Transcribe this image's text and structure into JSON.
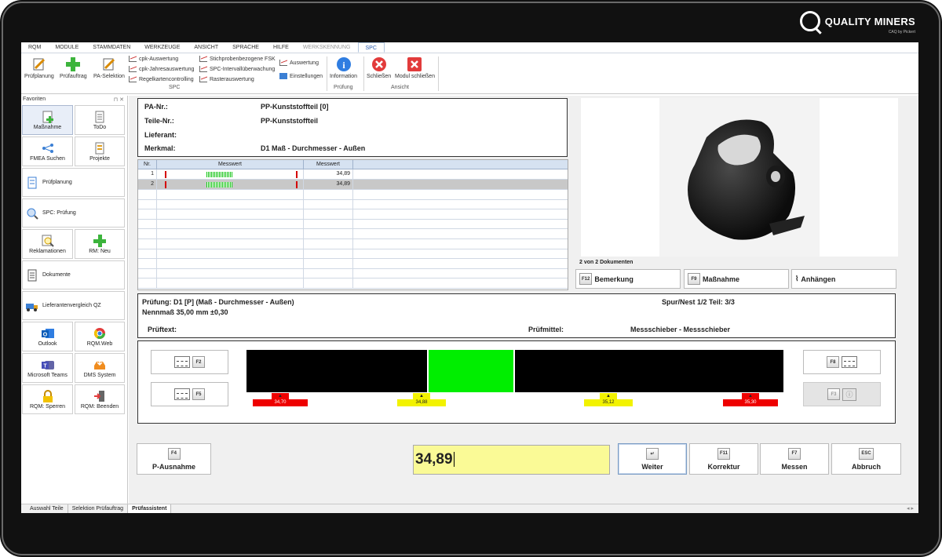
{
  "brand": {
    "name": "QUALITY MINERS",
    "sub": "CAQ by Pickert"
  },
  "menu": [
    "RQM",
    "MODULE",
    "STAMMDATEN",
    "WERKZEUGE",
    "ANSICHT",
    "SPRACHE",
    "HILFE",
    "WERKSKENNUNG",
    "SPC"
  ],
  "ribbon": {
    "pruefplanung": "Prüfplanung",
    "pruefauftrag": "Prüfauftrag",
    "paselektion": "PA-Selektion",
    "cpk_auswertung": "cpk-Auswertung",
    "cpk_jahres": "cpk-Jahresauswertung",
    "regelkarten": "Regelkartencontrolling",
    "stichproben": "Stichprobenbezogene FSK",
    "intervall": "SPC-Intervallüberwachung",
    "raster": "Rasterauswertung",
    "auswertung": "Auswertung",
    "einstellungen": "Einstellungen",
    "information": "Information",
    "schliessen": "Schließen",
    "modul_schliessen": "Modul schließen",
    "group_spc": "SPC",
    "group_pruefung": "Prüfung",
    "group_ansicht": "Ansicht"
  },
  "sidebar": {
    "title": "Favoriten",
    "items": {
      "massnahme": "Maßnahme",
      "todo": "ToDo",
      "fmea": "FMEA Suchen",
      "projekte": "Projekte",
      "pruefplanung": "Prüfplanung",
      "spc": "SPC: Prüfung",
      "reklamationen": "Reklamationen",
      "rmneu": "RM: Neu",
      "dokumente": "Dokumente",
      "lieferanten": "Lieferantenvergleich QZ",
      "outlook": "Outlook",
      "rqmweb": "RQM.Web",
      "teams": "Microsoft Teams",
      "dms": "DMS System",
      "sperren": "RQM: Sperren",
      "beenden": "RQM: Beenden"
    }
  },
  "info": {
    "pa_label": "PA-Nr.:",
    "pa_value": "PP-Kunststoffteil [0]",
    "teil_label": "Teile-Nr.:",
    "teil_value": "PP-Kunststoffteil",
    "lief_label": "Lieferant:",
    "lief_value": "",
    "merk_label": "Merkmal:",
    "merk_value": "D1 Maß - Durchmesser - Außen"
  },
  "grid": {
    "headers": [
      "Nr.",
      "Messwert",
      "Messwert"
    ],
    "rows": [
      {
        "nr": "1",
        "value": "34,89"
      },
      {
        "nr": "2",
        "value": "34,89"
      }
    ]
  },
  "docs": {
    "count": "2 von 2 Dokumenten",
    "bemerkung_key": "F12",
    "bemerkung": "Bemerkung",
    "massnahme_key": "F9",
    "massnahme": "Maßnahme",
    "anhaengen": "Anhängen"
  },
  "test": {
    "pruefung": "Prüfung: D1 [P] (Maß - Durchmesser - Außen)",
    "nennmass": "Nennmaß 35,00 mm ±0,30",
    "spur": "Spur/Nest 1/2 Teil: 3/3",
    "pruefmittel_label": "Prüfmittel:",
    "pruefmittel_value": "Messschieber - Messschieber",
    "pruefmittel_text_label": "Prüftext:"
  },
  "gauge": {
    "f2": "F2",
    "f5": "F5",
    "f8": "F8",
    "f3": "F3",
    "markers": [
      "34,70",
      "34,88",
      "35,12",
      "35,30"
    ],
    "colors": {
      "red": "#ee0000",
      "yellow": "#f2f200",
      "green": "#00ee00"
    }
  },
  "actions": {
    "f4_key": "F4",
    "f4": "P-Ausnahme",
    "input": "34,89",
    "weiter": "Weiter",
    "f11_key": "F11",
    "korrektur": "Korrektur",
    "f7_key": "F7",
    "messen": "Messen",
    "esc_key": "ESC",
    "abbruch": "Abbruch"
  },
  "tabs": [
    "Auswahl Teile",
    "Selektion Prüfauftrag",
    "Prüfassistent"
  ]
}
